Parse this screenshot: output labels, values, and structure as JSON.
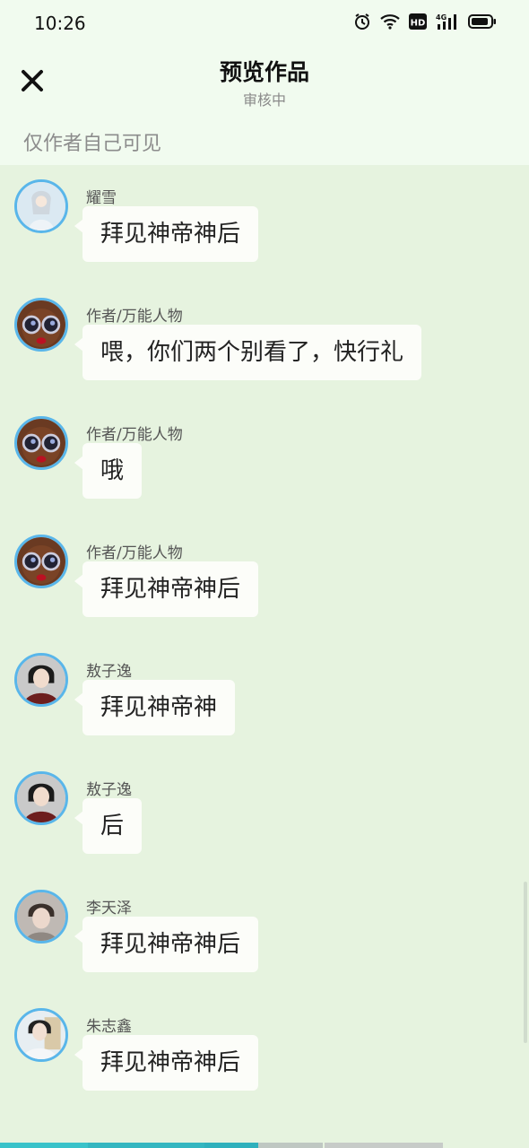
{
  "status_bar": {
    "time": "10:26"
  },
  "header": {
    "title": "预览作品",
    "subtitle": "审核中",
    "visibility_note": "仅作者自己可见"
  },
  "messages": [
    {
      "sender": "耀雪",
      "text": "拜见神帝神后",
      "avatar": "girl-white-avatar"
    },
    {
      "sender": "作者/万能人物",
      "text": "喂，你们两个别看了，快行礼",
      "avatar": "goggle-monster-avatar"
    },
    {
      "sender": "作者/万能人物",
      "text": "哦",
      "avatar": "goggle-monster-avatar"
    },
    {
      "sender": "作者/万能人物",
      "text": "拜见神帝神后",
      "avatar": "goggle-monster-avatar"
    },
    {
      "sender": "敖子逸",
      "text": "拜见神帝神",
      "avatar": "boy-red-robe-avatar"
    },
    {
      "sender": "敖子逸",
      "text": "后",
      "avatar": "boy-red-robe-avatar"
    },
    {
      "sender": "李天泽",
      "text": "拜见神帝神后",
      "avatar": "boy-portrait-avatar"
    },
    {
      "sender": "朱志鑫",
      "text": "拜见神帝神后",
      "avatar": "boy-light-robe-avatar"
    }
  ],
  "colors": {
    "background": "#e6f3df",
    "header": "#f1fbef",
    "avatar_border": "#59b6ea",
    "bubble": "#fcfdf9"
  }
}
